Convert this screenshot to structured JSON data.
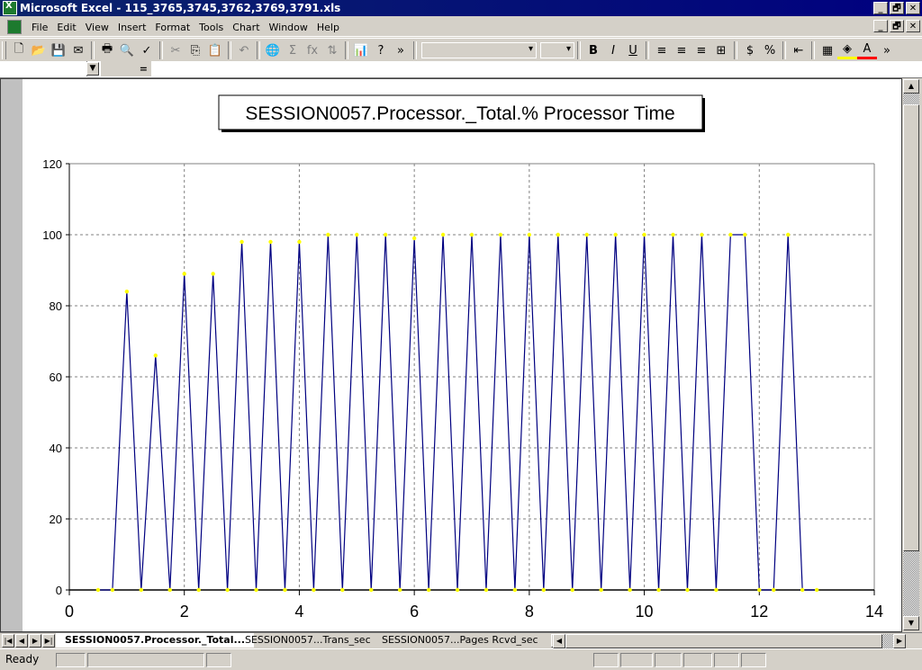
{
  "window": {
    "title": "Microsoft Excel - 115_3765,3745,3762,3769,3791.xls",
    "buttons": [
      "_",
      "🗗",
      "✕"
    ]
  },
  "menubar": {
    "items": [
      "File",
      "Edit",
      "View",
      "Insert",
      "Format",
      "Tools",
      "Chart",
      "Window",
      "Help"
    ]
  },
  "toolbar": {
    "standard": [
      {
        "name": "new-icon",
        "glyph": "🗋"
      },
      {
        "name": "open-icon",
        "glyph": "📂"
      },
      {
        "name": "save-icon",
        "glyph": "💾"
      },
      {
        "name": "email-icon",
        "glyph": "✉"
      },
      {
        "name": "print-icon",
        "glyph": "🖶"
      },
      {
        "name": "print-preview-icon",
        "glyph": "🔍"
      },
      {
        "name": "spelling-icon",
        "glyph": "✓"
      },
      {
        "name": "cut-icon",
        "glyph": "✂",
        "disabled": true
      },
      {
        "name": "copy-icon",
        "glyph": "⎘"
      },
      {
        "name": "paste-icon",
        "glyph": "📋",
        "disabled": true
      },
      {
        "name": "undo-icon",
        "glyph": "↶",
        "disabled": true
      },
      {
        "name": "hyperlink-icon",
        "glyph": "🌐",
        "disabled": true
      },
      {
        "name": "autosum-icon",
        "glyph": "Σ",
        "disabled": true
      },
      {
        "name": "function-icon",
        "glyph": "fx",
        "disabled": true
      },
      {
        "name": "sort-ascending-icon",
        "glyph": "⇅",
        "disabled": true
      },
      {
        "name": "chart-wizard-icon",
        "glyph": "📊"
      },
      {
        "name": "help-icon",
        "glyph": "?"
      },
      {
        "name": "more-icon",
        "glyph": "»"
      }
    ],
    "font_name": "",
    "font_size": "",
    "formatting": [
      {
        "name": "bold-icon",
        "glyph": "B"
      },
      {
        "name": "italic-icon",
        "glyph": "I"
      },
      {
        "name": "underline-icon",
        "glyph": "U"
      },
      {
        "name": "align-left-icon",
        "glyph": "≡"
      },
      {
        "name": "align-center-icon",
        "glyph": "≡"
      },
      {
        "name": "align-right-icon",
        "glyph": "≡"
      },
      {
        "name": "merge-center-icon",
        "glyph": "⊞"
      },
      {
        "name": "currency-icon",
        "glyph": "$"
      },
      {
        "name": "percent-icon",
        "glyph": "%"
      },
      {
        "name": "decrease-indent-icon",
        "glyph": "⇤"
      },
      {
        "name": "borders-icon",
        "glyph": "▦"
      },
      {
        "name": "fill-color-icon",
        "glyph": "◈",
        "color": "#ffff00"
      },
      {
        "name": "font-color-icon",
        "glyph": "A",
        "color": "#ff0000"
      },
      {
        "name": "more-icon",
        "glyph": "»"
      }
    ]
  },
  "formula_bar": {
    "name_box": "",
    "equals": "=",
    "content": ""
  },
  "chart_data": {
    "type": "line",
    "title": "SESSION0057.Processor._Total.% Processor Time",
    "xlabel": "",
    "ylabel": "",
    "xlim": [
      0,
      14
    ],
    "ylim": [
      0,
      120
    ],
    "xticks": [
      0,
      2,
      4,
      6,
      8,
      10,
      12,
      14
    ],
    "yticks": [
      0,
      20,
      40,
      60,
      80,
      100,
      120
    ],
    "grid": true,
    "legend": "none",
    "series": [
      {
        "name": "% Processor Time",
        "line_color": "#000080",
        "marker_color": "#ffff00",
        "x": [
          0.5,
          0.75,
          1.0,
          1.25,
          1.5,
          1.75,
          2.0,
          2.25,
          2.5,
          2.75,
          3.0,
          3.25,
          3.5,
          3.75,
          4.0,
          4.25,
          4.5,
          4.75,
          5.0,
          5.25,
          5.5,
          5.75,
          6.0,
          6.25,
          6.5,
          6.75,
          7.0,
          7.25,
          7.5,
          7.75,
          8.0,
          8.25,
          8.5,
          8.75,
          9.0,
          9.25,
          9.5,
          9.75,
          10.0,
          10.25,
          10.5,
          10.75,
          11.0,
          11.25,
          11.5,
          11.75,
          12.0,
          12.25,
          12.5,
          12.75,
          13.0
        ],
        "y": [
          0,
          0,
          84,
          0,
          66,
          0,
          89,
          0,
          89,
          0,
          98,
          0,
          98,
          0,
          98,
          0,
          100,
          0,
          100,
          0,
          100,
          0,
          99,
          0,
          100,
          0,
          100,
          0,
          100,
          0,
          100,
          0,
          100,
          0,
          100,
          0,
          100,
          0,
          100,
          0,
          100,
          0,
          100,
          0,
          100,
          100,
          0,
          0,
          100,
          0,
          0
        ]
      }
    ]
  },
  "sheet_tabs": {
    "nav": [
      "|◀",
      "◀",
      "▶",
      "▶|"
    ],
    "tabs": [
      "SESSION0057.Processor._Total...",
      "SESSION0057...Trans_sec",
      "SESSION0057...Pages Rcvd_sec"
    ],
    "active": 0
  },
  "statusbar": {
    "text": "Ready"
  }
}
